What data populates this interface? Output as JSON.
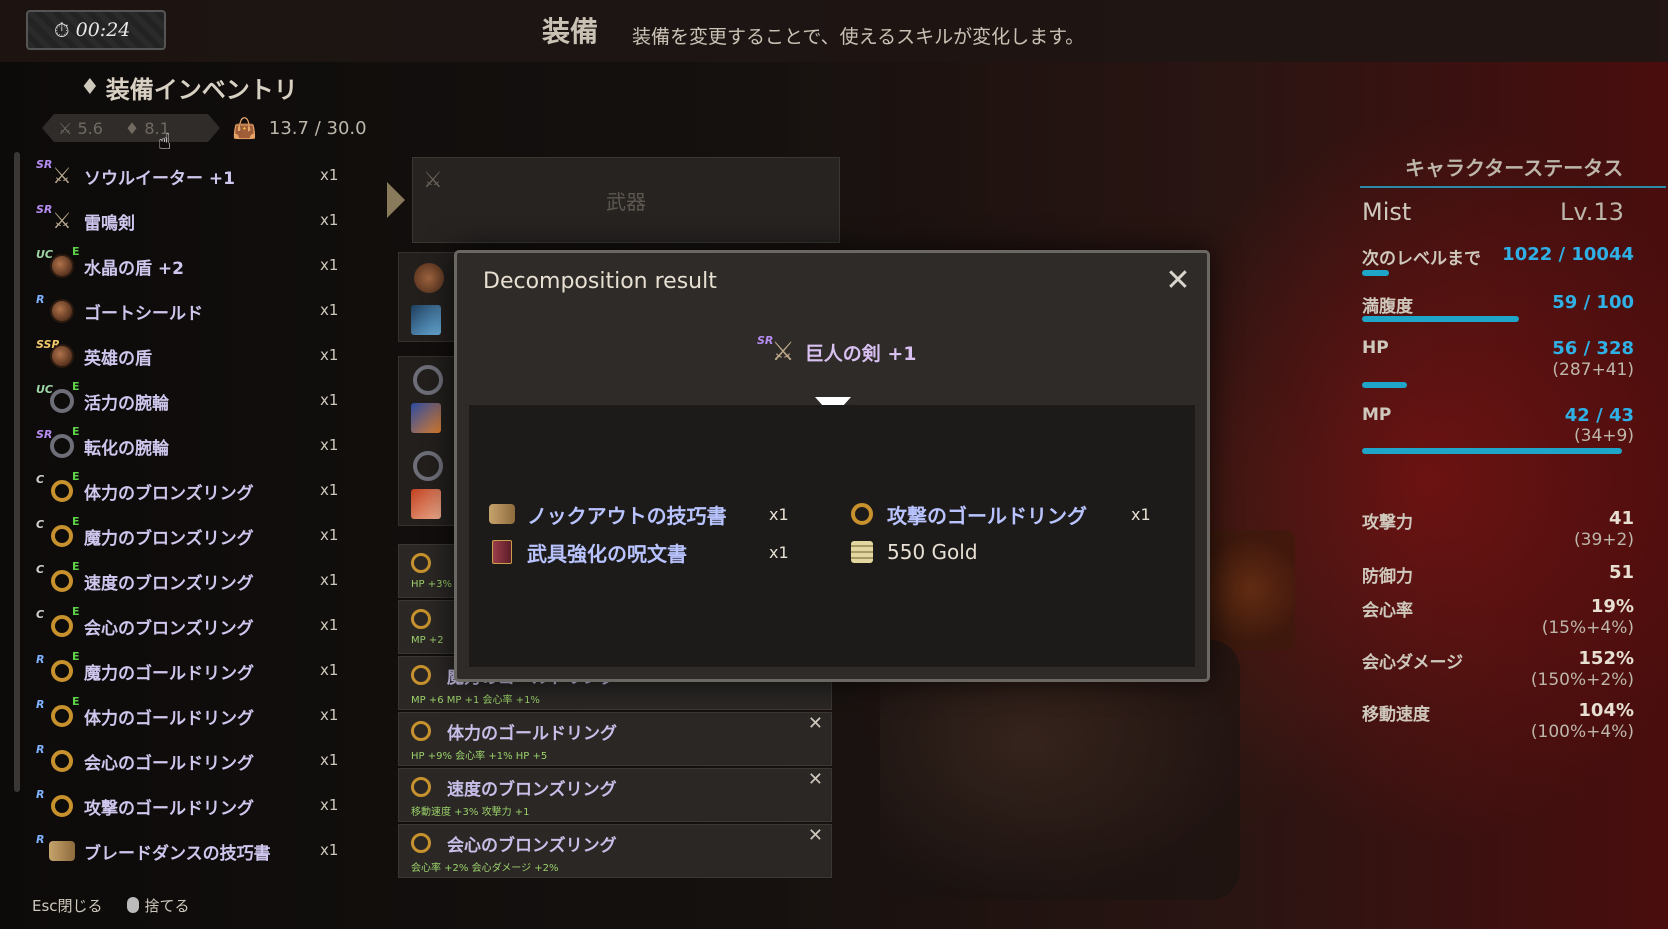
{
  "topbar": {
    "timer": "00:24",
    "title": "装備",
    "subtitle": "装備を変更することで、使えるスキルが変化します。"
  },
  "inventory": {
    "title": "装備インベントリ",
    "filter_a": "5.6",
    "filter_b": "8.1",
    "weight": "13.7 / 30.0",
    "items": [
      {
        "rarity": "SR",
        "equipped": false,
        "icon": "sword-icon",
        "name": "ソウルイーター +1",
        "qty": "x1"
      },
      {
        "rarity": "SR",
        "equipped": false,
        "icon": "sword-icon",
        "name": "雷鳴剣",
        "qty": "x1"
      },
      {
        "rarity": "UC",
        "equipped": true,
        "icon": "shield-icon",
        "name": "水晶の盾 +2",
        "qty": "x1"
      },
      {
        "rarity": "R",
        "equipped": false,
        "icon": "shield-icon",
        "name": "ゴートシールド",
        "qty": "x1"
      },
      {
        "rarity": "SSR",
        "equipped": false,
        "icon": "shield-icon",
        "name": "英雄の盾",
        "qty": "x1"
      },
      {
        "rarity": "UC",
        "equipped": true,
        "icon": "bracelet-icon",
        "name": "活力の腕輪",
        "qty": "x1"
      },
      {
        "rarity": "SR",
        "equipped": true,
        "icon": "bracelet-icon",
        "name": "転化の腕輪",
        "qty": "x1"
      },
      {
        "rarity": "C",
        "equipped": true,
        "icon": "ring-icon",
        "name": "体力のブロンズリング",
        "qty": "x1"
      },
      {
        "rarity": "C",
        "equipped": true,
        "icon": "ring-icon",
        "name": "魔力のブロンズリング",
        "qty": "x1"
      },
      {
        "rarity": "C",
        "equipped": true,
        "icon": "ring-icon",
        "name": "速度のブロンズリング",
        "qty": "x1"
      },
      {
        "rarity": "C",
        "equipped": true,
        "icon": "ring-icon",
        "name": "会心のブロンズリング",
        "qty": "x1"
      },
      {
        "rarity": "R",
        "equipped": true,
        "icon": "ring-icon",
        "name": "魔力のゴールドリング",
        "qty": "x1"
      },
      {
        "rarity": "R",
        "equipped": true,
        "icon": "ring-icon",
        "name": "体力のゴールドリング",
        "qty": "x1"
      },
      {
        "rarity": "R",
        "equipped": false,
        "icon": "ring-icon",
        "name": "会心のゴールドリング",
        "qty": "x1"
      },
      {
        "rarity": "R",
        "equipped": false,
        "icon": "ring-icon",
        "name": "攻撃のゴールドリング",
        "qty": "x1"
      },
      {
        "rarity": "R",
        "equipped": false,
        "icon": "scroll-icon",
        "name": "ブレードダンスの技巧書",
        "qty": "x1"
      }
    ]
  },
  "footer": {
    "esc": "Esc閉じる",
    "discard": "捨てる"
  },
  "slots": {
    "weapon_label": "武器",
    "accessories": [
      {
        "name": "",
        "stats": "HP +3%"
      },
      {
        "name": "",
        "stats": "MP +2"
      },
      {
        "name": "魔力のゴールドリング",
        "stats": "MP +6  MP +1  会心率 +1%"
      },
      {
        "name": "体力のゴールドリング",
        "stats": "HP +9%  会心率 +1%  HP +5"
      },
      {
        "name": "速度のブロンズリング",
        "stats": "移動速度 +3%  攻撃力 +1"
      },
      {
        "name": "会心のブロンズリング",
        "stats": "会心率 +2%  会心ダメージ +2%"
      }
    ]
  },
  "status": {
    "title": "キャラクターステータス",
    "name": "Mist",
    "level": "Lv.13",
    "next_label": "次のレベルまで",
    "next_value": "1022 / 10044",
    "next_fraction": 0.102,
    "satiety_label": "満腹度",
    "satiety_value": "59 / 100",
    "satiety_fraction": 0.59,
    "hp_label": "HP",
    "hp_value": "56 / 328",
    "hp_sub": "(287+41)",
    "hp_fraction": 0.171,
    "mp_label": "MP",
    "mp_value": "42 / 43",
    "mp_sub": "(34+9)",
    "mp_fraction": 0.977,
    "stats": [
      {
        "label": "攻撃力",
        "value": "41",
        "sub": "(39+2)"
      },
      {
        "label": "防御力",
        "value": "51",
        "sub": ""
      },
      {
        "label": "会心率",
        "value": "19%",
        "sub": "(15%+4%)"
      },
      {
        "label": "会心ダメージ",
        "value": "152%",
        "sub": "(150%+2%)"
      },
      {
        "label": "移動速度",
        "value": "104%",
        "sub": "(100%+4%)"
      }
    ]
  },
  "modal": {
    "title": "Decomposition result",
    "close": "✕",
    "source_rarity": "SR",
    "source_name": "巨人の剣 +1",
    "results": [
      {
        "icon": "scroll-icon",
        "name": "ノックアウトの技巧書",
        "qty": "x1"
      },
      {
        "icon": "ring-icon",
        "name": "攻撃のゴールドリング",
        "qty": "x1"
      },
      {
        "icon": "book-icon",
        "name": "武具強化の呪文書",
        "qty": "x1"
      },
      {
        "icon": "gold-icon",
        "name": "550 Gold",
        "qty": ""
      }
    ]
  }
}
